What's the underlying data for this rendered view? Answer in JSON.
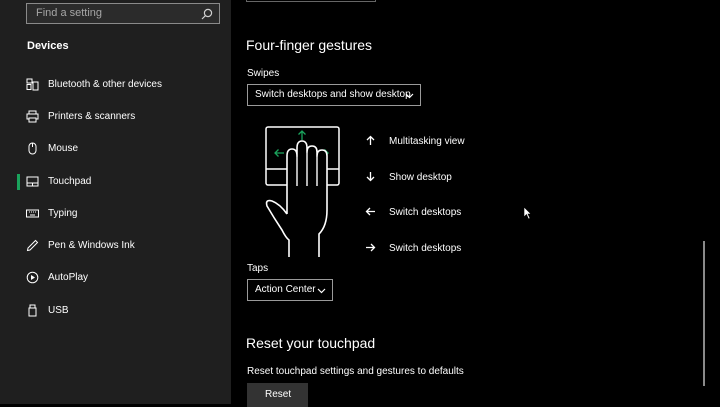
{
  "sidebar": {
    "search_placeholder": "Find a setting",
    "section_title": "Devices",
    "items": [
      {
        "label": "Bluetooth & other devices",
        "icon": "bluetooth-devices-icon",
        "selected": false
      },
      {
        "label": "Printers & scanners",
        "icon": "printer-icon",
        "selected": false
      },
      {
        "label": "Mouse",
        "icon": "mouse-icon",
        "selected": false
      },
      {
        "label": "Touchpad",
        "icon": "touchpad-icon",
        "selected": true
      },
      {
        "label": "Typing",
        "icon": "keyboard-icon",
        "selected": false
      },
      {
        "label": "Pen & Windows Ink",
        "icon": "pen-icon",
        "selected": false
      },
      {
        "label": "AutoPlay",
        "icon": "autoplay-icon",
        "selected": false
      },
      {
        "label": "USB",
        "icon": "usb-icon",
        "selected": false
      }
    ]
  },
  "main": {
    "four_finger_title": "Four-finger gestures",
    "swipes_label": "Swipes",
    "swipes_value": "Switch desktops and show desktop",
    "gestures": [
      {
        "direction": "up",
        "label": "Multitasking view"
      },
      {
        "direction": "down",
        "label": "Show desktop"
      },
      {
        "direction": "left",
        "label": "Switch desktops"
      },
      {
        "direction": "right",
        "label": "Switch desktops"
      }
    ],
    "taps_label": "Taps",
    "taps_value": "Action Center",
    "reset_title": "Reset your touchpad",
    "reset_desc": "Reset touchpad settings and gestures to defaults",
    "reset_button": "Reset"
  },
  "colors": {
    "accent": "#1aa35c",
    "sidebar_bg": "#1f1f1f",
    "main_bg": "#000000"
  }
}
